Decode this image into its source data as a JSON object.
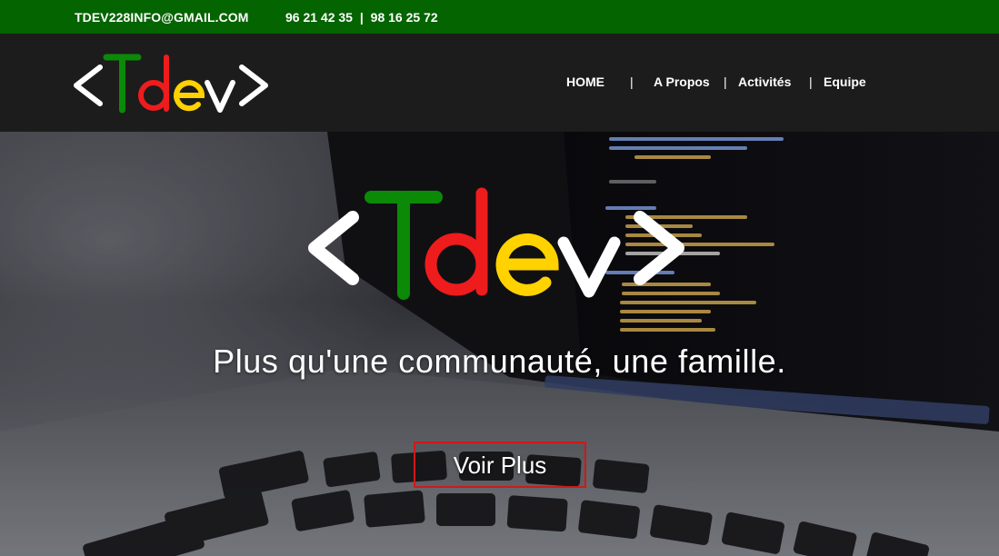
{
  "topbar": {
    "email": "TDEV228INFO@GMAIL.COM",
    "phone_1": "96 21 42 35",
    "phone_separator": "|",
    "phone_2": "98 16 25 72"
  },
  "brand": {
    "logo_text": "<Tdev>",
    "colors": {
      "bracket": "#ffffff",
      "T": "#0b8a07",
      "d": "#ee1c1c",
      "e": "#ffd200",
      "v": "#ffffff",
      "topbar": "#046400",
      "header": "#1c1c1c",
      "cta_border": "#d11818"
    }
  },
  "nav": {
    "items": [
      {
        "label": "HOME"
      },
      {
        "label": "A Propos"
      },
      {
        "label": "Activités"
      },
      {
        "label": "Equipe"
      }
    ],
    "divider": "|"
  },
  "hero": {
    "tagline": "Plus qu'une communauté, une famille.",
    "cta_label": "Voir Plus",
    "background_icon": "laptop-code-photo"
  }
}
